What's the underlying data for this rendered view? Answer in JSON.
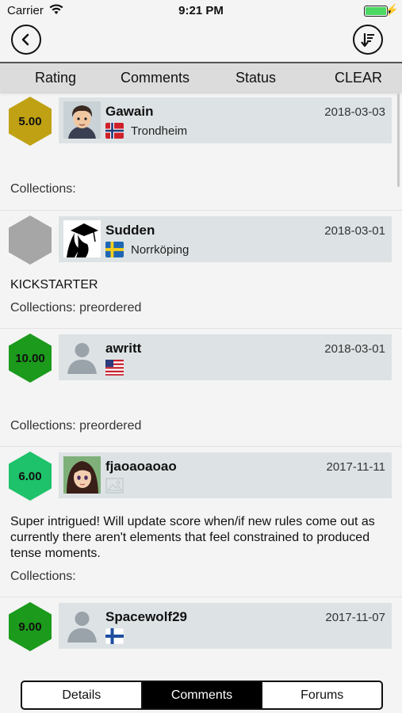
{
  "status_bar": {
    "carrier": "Carrier",
    "time": "9:21 PM"
  },
  "nav": {
    "back_icon": "back-arrow-icon",
    "sort_icon": "sort-down-icon"
  },
  "filters": {
    "rating": "Rating",
    "comments": "Comments",
    "status": "Status",
    "clear": "CLEAR"
  },
  "entries": [
    {
      "rating": "5.00",
      "rating_color": "#c0a114",
      "username": "Gawain",
      "date": "2018-03-03",
      "flag": "norway",
      "city": "Trondheim",
      "comment": "",
      "collections": "Collections:"
    },
    {
      "rating": "",
      "rating_color": "#a6a6a6",
      "username": "Sudden",
      "date": "2018-03-01",
      "flag": "sweden",
      "city": "Norrköping",
      "comment": "KICKSTARTER",
      "collections": "Collections: preordered"
    },
    {
      "rating": "10.00",
      "rating_color": "#1b9a1b",
      "username": "awritt",
      "date": "2018-03-01",
      "flag": "usa",
      "city": "",
      "comment": "",
      "collections": "Collections: preordered"
    },
    {
      "rating": "6.00",
      "rating_color": "#1ec26a",
      "username": "fjaoaoaoao",
      "date": "2017-11-11",
      "flag": "unknown",
      "city": "",
      "comment": "Super intrigued! Will update score when/if new rules come out as currently there aren't elements that feel constrained to produced tense moments.",
      "collections": "Collections:"
    },
    {
      "rating": "9.00",
      "rating_color": "#1b9a1b",
      "username": "Spacewolf29",
      "date": "2017-11-07",
      "flag": "finland",
      "city": "",
      "comment": "",
      "collections": ""
    }
  ],
  "tabs": {
    "details": "Details",
    "comments": "Comments",
    "forums": "Forums",
    "active": "Comments"
  }
}
